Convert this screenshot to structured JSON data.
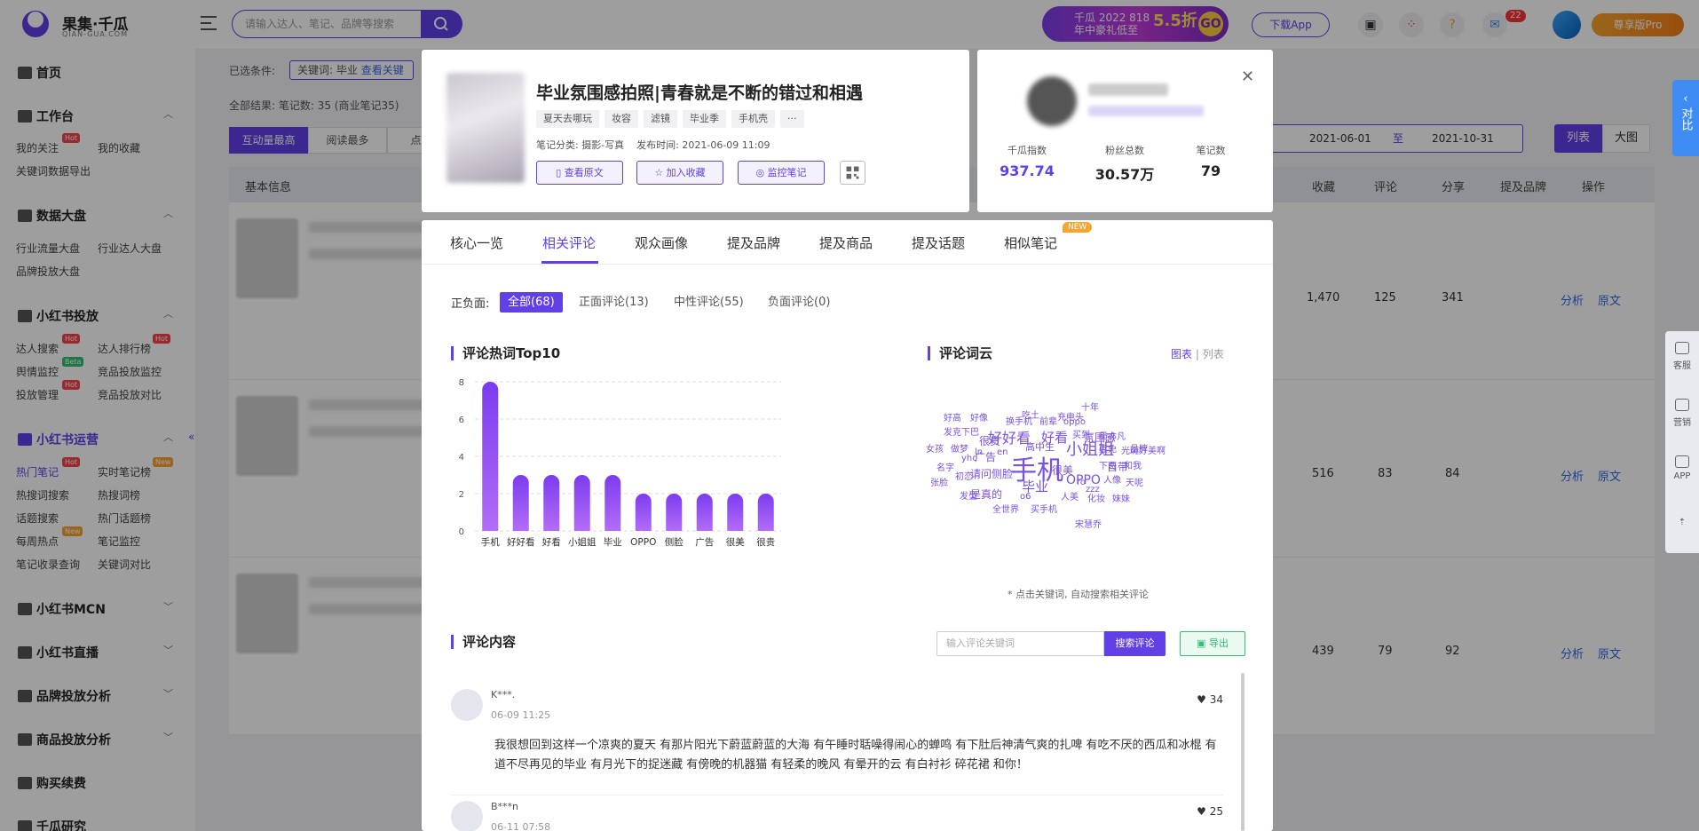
{
  "topbar": {
    "brand": "果集·千瓜",
    "brand_sub": "QIAN-GUA.COM",
    "search_placeholder": "请输入达人、笔记、品牌等搜索",
    "banner_line1": "千瓜 2022 818",
    "banner_line2": "年中豪礼低至",
    "banner_discount": "5.5折",
    "banner_go": "GO",
    "download_label": "下载App",
    "message_count": "22",
    "pro_label": "尊享版Pro"
  },
  "sidebar": {
    "home": "首页",
    "sections": [
      {
        "title": "工作台",
        "items": [
          "我的关注",
          "我的收藏",
          "关键词数据导出"
        ]
      },
      {
        "title": "数据大盘",
        "items": [
          "行业流量大盘",
          "行业达人大盘",
          "品牌投放大盘"
        ]
      },
      {
        "title": "小红书投放",
        "items": [
          "达人搜索",
          "达人排行榜",
          "舆情监控",
          "竞品投放监控",
          "投放管理",
          "竞品投放对比"
        ]
      },
      {
        "title": "小红书运营",
        "items": [
          "热门笔记",
          "实时笔记榜",
          "热搜词搜索",
          "热搜词榜",
          "话题搜索",
          "热门话题榜",
          "每周热点",
          "笔记监控",
          "笔记收录查询",
          "关键词对比"
        ]
      },
      {
        "title": "小红书MCN"
      },
      {
        "title": "小红书直播"
      },
      {
        "title": "品牌投放分析"
      },
      {
        "title": "商品投放分析"
      },
      {
        "title": "购买续费"
      },
      {
        "title": "千瓜研究"
      }
    ],
    "tags": {
      "hot": "Hot",
      "beta": "Beta",
      "new": "New"
    }
  },
  "main": {
    "filters_label": "已选条件:",
    "filter_tag": "关键词: 毕业",
    "filter_link": "查看关键",
    "total": "全部结果:   笔记数: 35  (商业笔记35)",
    "sort_buttons": [
      "互动量最高",
      "阅读最多",
      "点赞最"
    ],
    "date_from": "2021-06-01",
    "date_to_label": "至",
    "date_to": "2021-10-31",
    "view_list": "列表",
    "view_big": "大图",
    "headers": [
      "基本信息",
      "收藏",
      "评论",
      "分享",
      "提及品牌",
      "操作"
    ],
    "rows": [
      {
        "collect": "1,470",
        "comment": "125",
        "share": "341"
      },
      {
        "collect": "516",
        "comment": "83",
        "share": "84"
      },
      {
        "collect": "439",
        "comment": "79",
        "share": "92"
      }
    ],
    "analyze": "分析",
    "original": "原文"
  },
  "note": {
    "title": "毕业氛围感拍照|青春就是不断的错过和相遇",
    "tags": [
      "夏天去哪玩",
      "妆容",
      "滤镜",
      "毕业季",
      "手机壳",
      "···"
    ],
    "category": "笔记分类: 摄影-写真",
    "publish_time": "发布时间: 2021-06-09 11:09",
    "actions": [
      "查看原文",
      "加入收藏",
      "监控笔记"
    ]
  },
  "author": {
    "stats": [
      {
        "label": "千瓜指数",
        "value": "937.74"
      },
      {
        "label": "粉丝总数",
        "value": "30.57万"
      },
      {
        "label": "笔记数",
        "value": "79"
      }
    ]
  },
  "panel": {
    "tabs": [
      "核心一览",
      "相关评论",
      "观众画像",
      "提及品牌",
      "提及商品",
      "提及话题",
      "相似笔记"
    ],
    "new_badge": "NEW",
    "sentiment_label": "正负面:",
    "sentiment": [
      "全部(68)",
      "正面评论(13)",
      "中性评论(55)",
      "负面评论(0)"
    ],
    "hot_title": "评论热词Top10",
    "cloud_title": "评论词云",
    "view_chart": "图表",
    "view_list": "列表",
    "cloud_hint": "* 点击关键词, 自动搜索相关评论",
    "comments_title": "评论内容",
    "comment_search_placeholder": "输入评论关键词",
    "search_btn": "搜索评论",
    "export_btn": "导出",
    "comments": [
      {
        "user": "K***.",
        "time": "06-09 11:25",
        "likes": "34",
        "text": "我很想回到这样一个凉爽的夏天 有那片阳光下蔚蓝蔚蓝的大海 有午睡时聒噪得闹心的蝉鸣 有下肚后神清气爽的扎啤 有吃不厌的西瓜和冰棍 有道不尽再见的毕业 有月光下的捉迷藏 有傍晚的机器猫 有轻柔的晚风 有晕开的云 有白衬衫 碎花裙 和你！"
      },
      {
        "user": "B***n",
        "time": "06-11 07:58",
        "likes": "25",
        "text": ""
      }
    ],
    "wordcloud": [
      "手机",
      "小姐姐",
      "好好看",
      "好看",
      "毕业",
      "OPPO",
      "广告",
      "请问侧脸",
      "是真的",
      "高中生",
      "氛围感",
      "自带",
      "很美",
      "很贵",
      "换手机",
      "吃土",
      "充电头",
      "十年",
      "好高",
      "好像",
      "前辈",
      "oppo",
      "买到",
      "吴亦凡",
      "发克下巴",
      "互免",
      "品牌",
      "女孩",
      "做梦",
      "yhc",
      "ln",
      "en",
      "光斑",
      "好美啊",
      "名字",
      "和我",
      "下两",
      "人像",
      "初恋",
      "张脸",
      "天呢",
      "发型",
      "全世界",
      "买手机",
      "人美",
      "化妆",
      "妹妹",
      "宋慧乔",
      "o6",
      "zzz",
      "ro"
    ]
  },
  "rail": {
    "compare": "对比",
    "tools": [
      "客服",
      "营销",
      "APP"
    ]
  },
  "chart_data": {
    "type": "bar",
    "title": "评论热词Top10",
    "categories": [
      "手机",
      "好好看",
      "好看",
      "小姐姐",
      "毕业",
      "OPPO",
      "侧脸",
      "广告",
      "很美",
      "很贵"
    ],
    "values": [
      8,
      3,
      3,
      3,
      3,
      2,
      2,
      2,
      2,
      2
    ],
    "ylim": [
      0,
      8
    ],
    "yticks": [
      0,
      2,
      4,
      6,
      8
    ],
    "color": "#8a3ff2",
    "grid": true
  }
}
